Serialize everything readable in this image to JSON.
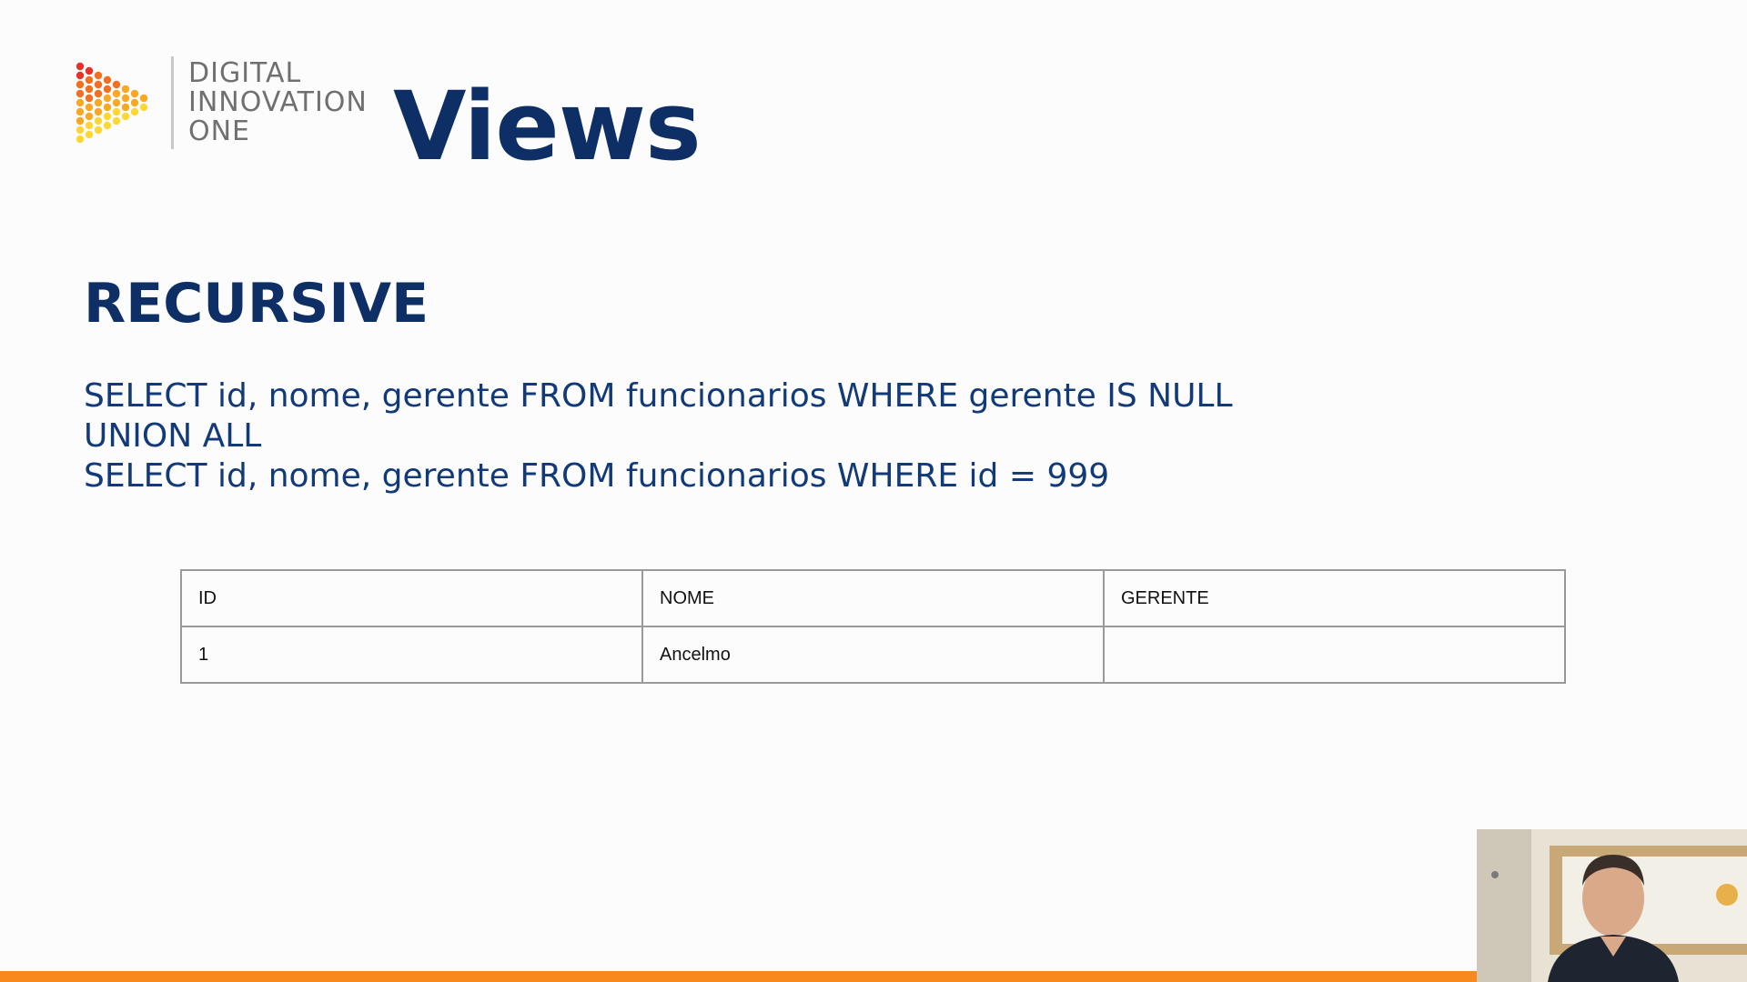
{
  "logo": {
    "lines": [
      "DIGITAL",
      "INNOVATION",
      "ONE"
    ],
    "dot_colors": [
      "#e63329",
      "#f37021",
      "#f9a825",
      "#fdd835"
    ]
  },
  "slide": {
    "title": "Views",
    "heading": "RECURSIVE",
    "sql_lines": [
      "SELECT id, nome, gerente FROM funcionarios WHERE gerente IS NULL",
      "UNION ALL",
      "SELECT id, nome, gerente FROM funcionarios WHERE id = 999"
    ]
  },
  "table": {
    "headers": [
      "ID",
      "NOME",
      "GERENTE"
    ],
    "rows": [
      [
        "1",
        "Ancelmo",
        ""
      ]
    ]
  },
  "colors": {
    "title": "#0e2f66",
    "sql_text": "#123a78",
    "accent_bar": "#f7891d",
    "table_border": "#9a9a9a"
  }
}
